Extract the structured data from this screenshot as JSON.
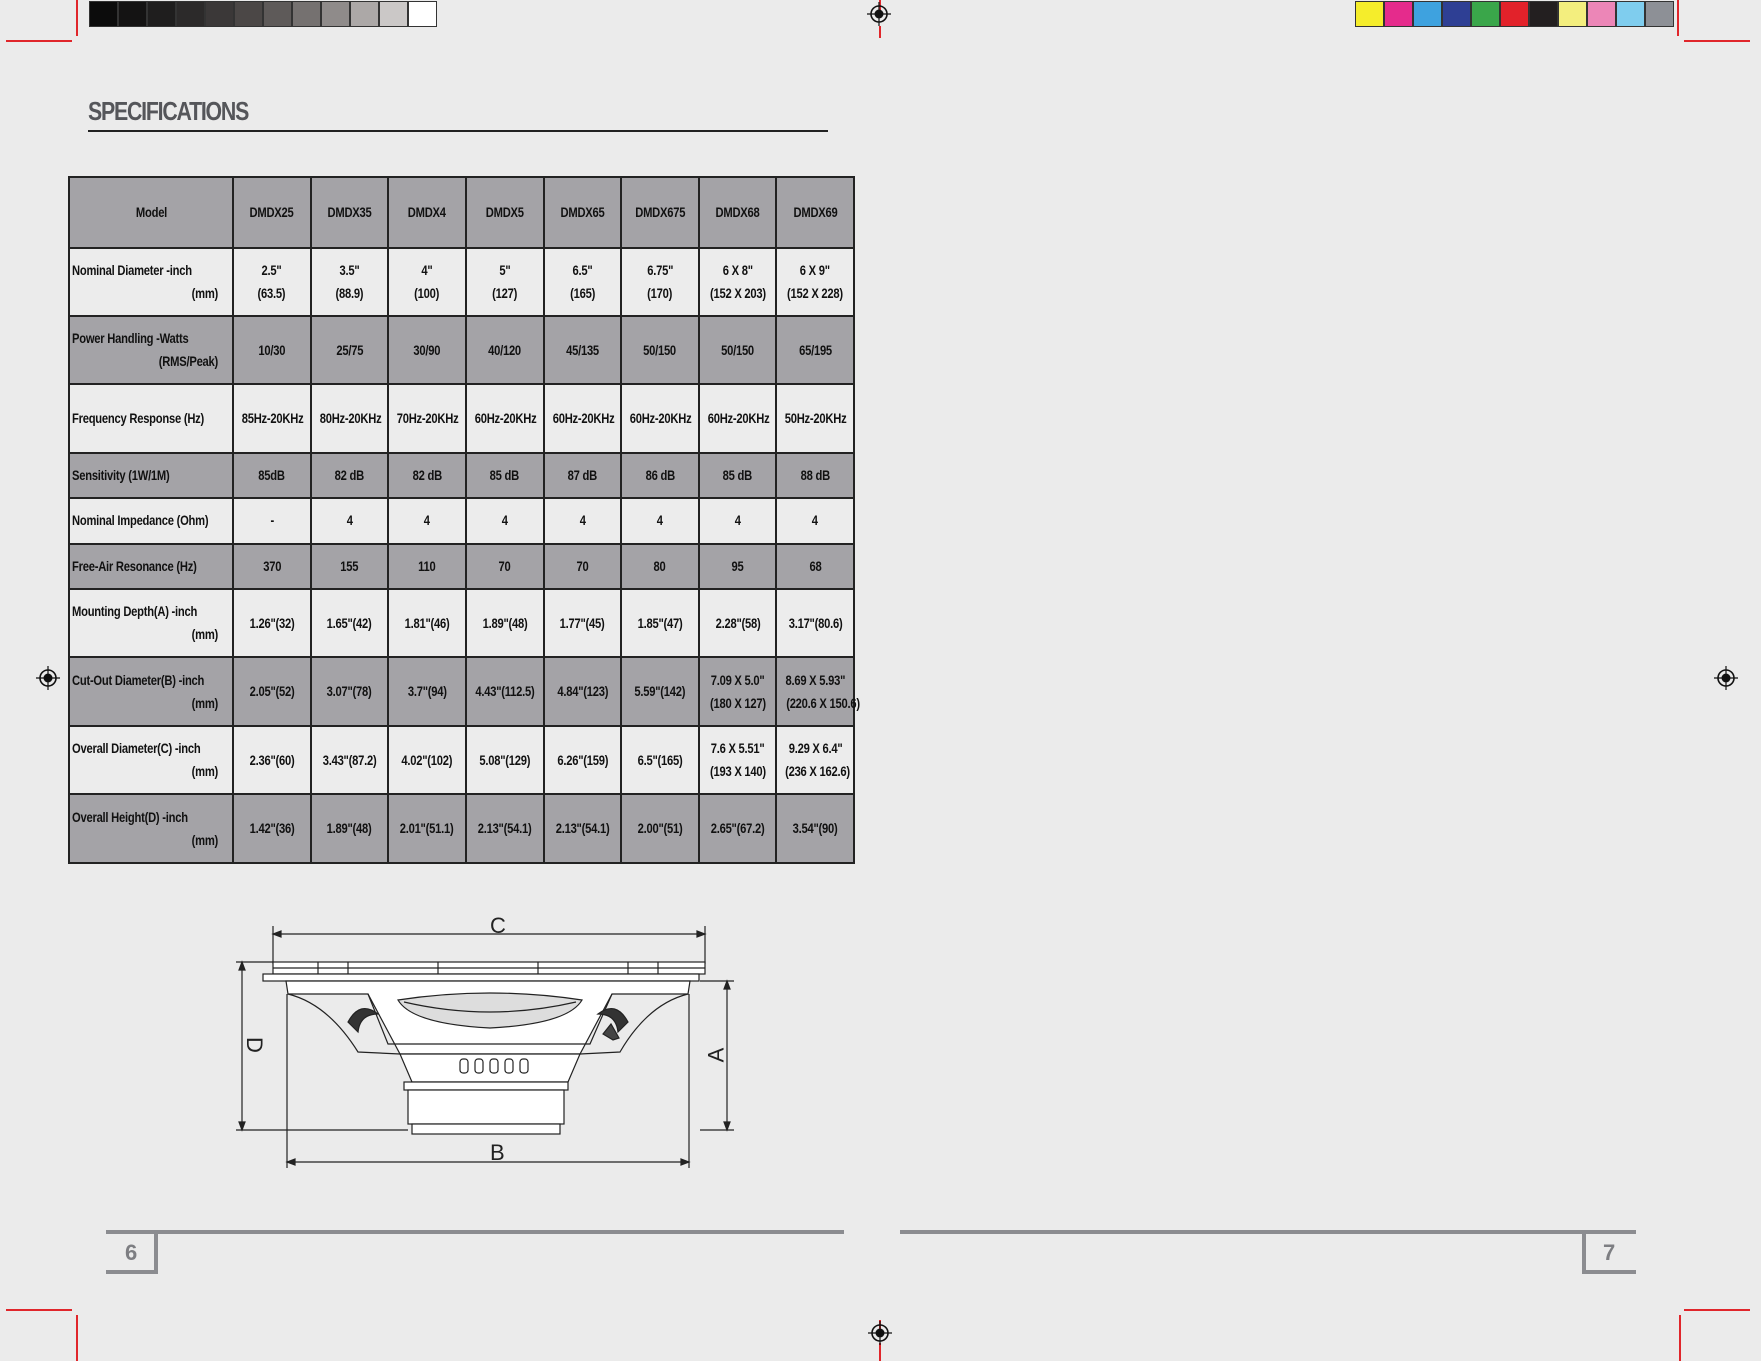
{
  "heading": "SPECIFICATIONS",
  "spec_table": {
    "header": [
      "Model",
      "DMDX25",
      "DMDX35",
      "DMDX4",
      "DMDX5",
      "DMDX65",
      "DMDX675",
      "DMDX68",
      "DMDX69"
    ],
    "rows": [
      {
        "label1": "Nominal Diameter -inch",
        "label2": "(mm)",
        "values": [
          [
            "2.5\"",
            "(63.5)"
          ],
          [
            "3.5\"",
            "(88.9)"
          ],
          [
            "4\"",
            "(100)"
          ],
          [
            "5\"",
            "(127)"
          ],
          [
            "6.5\"",
            "(165)"
          ],
          [
            "6.75\"",
            "(170)"
          ],
          [
            "6 X 8\"",
            "(152 X 203)"
          ],
          [
            "6 X 9\"",
            "(152 X 228)"
          ]
        ]
      },
      {
        "label1": "Power Handling  -Watts",
        "label2": "(RMS/Peak)",
        "values": [
          [
            "10/30"
          ],
          [
            "25/75"
          ],
          [
            "30/90"
          ],
          [
            "40/120"
          ],
          [
            "45/135"
          ],
          [
            "50/150"
          ],
          [
            "50/150"
          ],
          [
            "65/195"
          ]
        ]
      },
      {
        "label1": "Frequency Response (Hz)",
        "label2": "",
        "values": [
          [
            "85Hz-20KHz"
          ],
          [
            "80Hz-20KHz"
          ],
          [
            "70Hz-20KHz"
          ],
          [
            "60Hz-20KHz"
          ],
          [
            "60Hz-20KHz"
          ],
          [
            "60Hz-20KHz"
          ],
          [
            "60Hz-20KHz"
          ],
          [
            "50Hz-20KHz"
          ]
        ]
      },
      {
        "label1": "Sensitivity (1W/1M)",
        "label2": "",
        "values": [
          [
            "85dB"
          ],
          [
            "82 dB"
          ],
          [
            "82 dB"
          ],
          [
            "85 dB"
          ],
          [
            "87 dB"
          ],
          [
            "86 dB"
          ],
          [
            "85 dB"
          ],
          [
            "88 dB"
          ]
        ]
      },
      {
        "label1": "Nominal Impedance (Ohm)",
        "label2": "",
        "values": [
          [
            "-"
          ],
          [
            "4"
          ],
          [
            "4"
          ],
          [
            "4"
          ],
          [
            "4"
          ],
          [
            "4"
          ],
          [
            "4"
          ],
          [
            "4"
          ]
        ]
      },
      {
        "label1": "Free-Air Resonance (Hz)",
        "label2": "",
        "values": [
          [
            "370"
          ],
          [
            "155"
          ],
          [
            "110"
          ],
          [
            "70"
          ],
          [
            "70"
          ],
          [
            "80"
          ],
          [
            "95"
          ],
          [
            "68"
          ]
        ]
      },
      {
        "label1": "Mounting Depth(A)    -inch",
        "label2": "(mm)",
        "values": [
          [
            "1.26\"(32)"
          ],
          [
            "1.65\"(42)"
          ],
          [
            "1.81\"(46)"
          ],
          [
            "1.89\"(48)"
          ],
          [
            "1.77\"(45)"
          ],
          [
            "1.85\"(47)"
          ],
          [
            "2.28\"(58)"
          ],
          [
            "3.17\"(80.6)"
          ]
        ]
      },
      {
        "label1": "Cut-Out Diameter(B) -inch",
        "label2": "(mm)",
        "values": [
          [
            "2.05\"(52)"
          ],
          [
            "3.07\"(78)"
          ],
          [
            "3.7\"(94)"
          ],
          [
            "4.43\"(112.5)"
          ],
          [
            "4.84\"(123)"
          ],
          [
            "5.59\"(142)"
          ],
          [
            "7.09 X 5.0\"",
            "(180 X 127)"
          ],
          [
            "8.69 X 5.93\"",
            "(220.6 X 150.6)"
          ]
        ]
      },
      {
        "label1": "Overall Diameter(C) -inch",
        "label2": "(mm)",
        "values": [
          [
            "2.36\"(60)"
          ],
          [
            "3.43\"(87.2)"
          ],
          [
            "4.02\"(102)"
          ],
          [
            "5.08\"(129)"
          ],
          [
            "6.26\"(159)"
          ],
          [
            "6.5\"(165)"
          ],
          [
            "7.6 X 5.51\"",
            "(193 X 140)"
          ],
          [
            "9.29 X 6.4\"",
            "(236 X 162.6)"
          ]
        ]
      },
      {
        "label1": "Overall Height(D)     -inch",
        "label2": "(mm)",
        "values": [
          [
            "1.42\"(36)"
          ],
          [
            "1.89\"(48)"
          ],
          [
            "2.01\"(51.1)"
          ],
          [
            "2.13\"(54.1)"
          ],
          [
            "2.13\"(54.1)"
          ],
          [
            "2.00\"(51)"
          ],
          [
            "2.65\"(67.2)"
          ],
          [
            "3.54\"(90)"
          ]
        ]
      }
    ],
    "row_shading": [
      "dark",
      "light",
      "dark",
      "light",
      "dark",
      "light",
      "dark",
      "light",
      "dark",
      "light",
      "dark"
    ]
  },
  "diagram": {
    "label_a": "A",
    "label_b": "B",
    "label_c": "C",
    "label_d": "D"
  },
  "page_left": "6",
  "page_right": "7",
  "gray_swatches": [
    "#0c0c0c",
    "#141313",
    "#1f1e1e",
    "#2c2a2a",
    "#3b3838",
    "#4b4746",
    "#5e5a59",
    "#757170",
    "#8f8b8a",
    "#aca8a7",
    "#cbc8c7",
    "#ffffff"
  ],
  "color_swatches": [
    "#f5ed2b",
    "#e52b8c",
    "#3ea2df",
    "#2e3f94",
    "#3aa64a",
    "#e2222a",
    "#231f20",
    "#f3ee7e",
    "#ec86b7",
    "#7fcdee",
    "#8d9096"
  ]
}
